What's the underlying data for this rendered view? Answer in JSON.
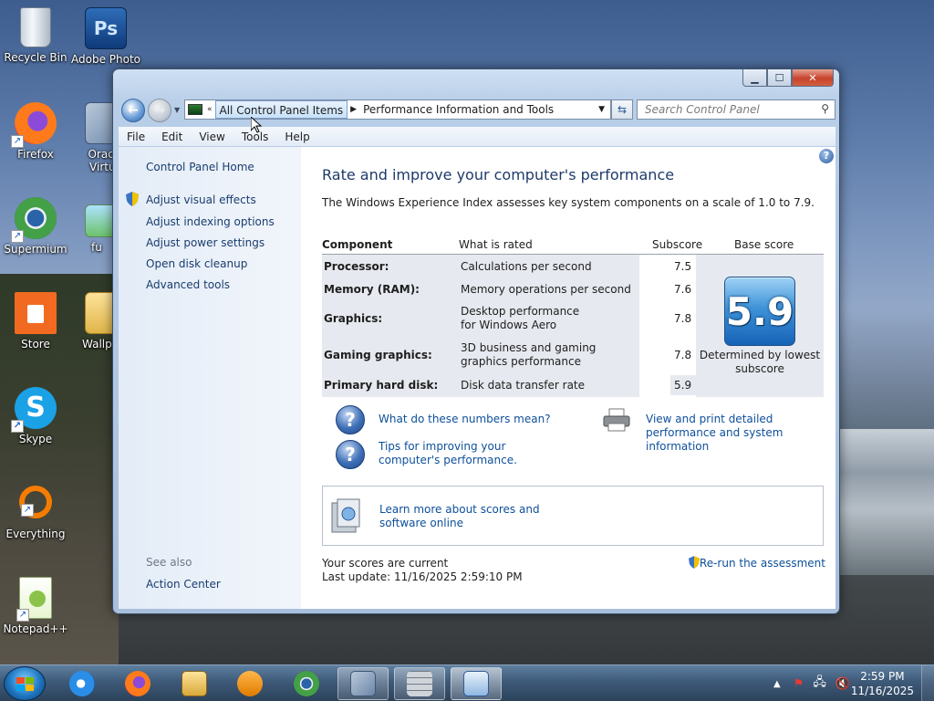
{
  "desktop": {
    "icons": [
      {
        "label": "Recycle Bin",
        "icon": "recycle-bin-icon"
      },
      {
        "label": "Firefox",
        "icon": "firefox-icon"
      },
      {
        "label": "Supermium",
        "icon": "supermium-icon"
      },
      {
        "label": "Store",
        "icon": "store-icon"
      },
      {
        "label": "Skype",
        "icon": "skype-icon"
      },
      {
        "label": "Everything",
        "icon": "everything-icon"
      },
      {
        "label": "Notepad++",
        "icon": "notepad-plus-plus-icon"
      },
      {
        "label": "Adobe Photo",
        "icon": "photoshop-icon"
      },
      {
        "label": "Oracle Virtua",
        "icon": "virtualbox-icon"
      },
      {
        "label": "fu",
        "icon": "image-file-icon"
      },
      {
        "label": "Wallp",
        "icon": "folder-icon"
      }
    ]
  },
  "window": {
    "address": {
      "chevron": "«",
      "segment1": "All Control Panel Items",
      "segment2": "Performance Information and Tools"
    },
    "search": {
      "placeholder": "Search Control Panel"
    },
    "menu": [
      "File",
      "Edit",
      "View",
      "Tools",
      "Help"
    ],
    "sidebar": {
      "home": "Control Panel Home",
      "items": [
        "Adjust visual effects",
        "Adjust indexing options",
        "Adjust power settings",
        "Open disk cleanup",
        "Advanced tools"
      ],
      "see_also": "See also",
      "action_center": "Action Center"
    },
    "main": {
      "title": "Rate and improve your computer's performance",
      "description": "The Windows Experience Index assesses key system components on a scale of 1.0 to 7.9.",
      "headers": {
        "component": "Component",
        "rated": "What is rated",
        "subscore": "Subscore",
        "base": "Base score"
      },
      "rows": [
        {
          "component": "Processor:",
          "rated": "Calculations per second",
          "subscore": "7.5"
        },
        {
          "component": "Memory (RAM):",
          "rated": "Memory operations per second",
          "subscore": "7.6"
        },
        {
          "component": "Graphics:",
          "rated": "Desktop performance for Windows Aero",
          "subscore": "7.8"
        },
        {
          "component": "Gaming graphics:",
          "rated": "3D business and gaming graphics performance",
          "subscore": "7.8"
        },
        {
          "component": "Primary hard disk:",
          "rated": "Disk data transfer rate",
          "subscore": "5.9"
        }
      ],
      "base_score": "5.9",
      "determined_by": "Determined by lowest subscore",
      "links": {
        "numbers": "What do these numbers mean?",
        "tips": "Tips for improving your computer's performance.",
        "print": "View and print detailed performance and system information",
        "learn": "Learn more about scores and software online"
      },
      "status": "Your scores are current",
      "last_update": "Last update: 11/16/2025 2:59:10 PM",
      "rerun": "Re-run the assessment"
    }
  },
  "taskbar": {
    "time": "2:59 PM",
    "date": "11/16/2025"
  }
}
